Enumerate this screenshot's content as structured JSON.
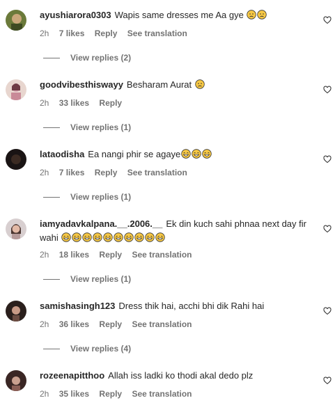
{
  "comments": [
    {
      "username": "ayushiarora0303",
      "text": "Wapis same dresses me Aa gye",
      "emojis": [
        "sad-face",
        "sad-face"
      ],
      "time": "2h",
      "likes": "7 likes",
      "reply": "Reply",
      "translate": "See translation",
      "view_replies": "View replies (2)",
      "avatar_colors": [
        "#6b7a3a",
        "#c9a77a"
      ]
    },
    {
      "username": "goodvibesthiswayy",
      "text": "Besharam Aurat",
      "emojis": [
        "sad-face"
      ],
      "time": "2h",
      "likes": "33 likes",
      "reply": "Reply",
      "translate": "",
      "view_replies": "View replies (1)",
      "avatar_colors": [
        "#d9a6b2",
        "#6e3b45"
      ]
    },
    {
      "username": "lataodisha",
      "text": "Ea nangi phir se agaye",
      "emojis": [
        "laughing-face",
        "laughing-face",
        "laughing-face"
      ],
      "time": "2h",
      "likes": "7 likes",
      "reply": "Reply",
      "translate": "See translation",
      "view_replies": "View replies (1)",
      "avatar_colors": [
        "#1a1414",
        "#3b2a22"
      ]
    },
    {
      "username": "iamyadavkalpana.__.2006.__",
      "text": "Ek din kuch sahi phnaa next day fir wahi",
      "emojis": [
        "laughing-face",
        "laughing-face",
        "laughing-face",
        "laughing-face",
        "laughing-face",
        "laughing-face",
        "laughing-face",
        "laughing-face",
        "laughing-face",
        "laughing-face"
      ],
      "time": "2h",
      "likes": "18 likes",
      "reply": "Reply",
      "translate": "See translation",
      "view_replies": "View replies (1)",
      "avatar_colors": [
        "#d8cfd0",
        "#4a3530"
      ]
    },
    {
      "username": "samishasingh123",
      "text": "Dress thik hai, acchi bhi dik Rahi hai",
      "emojis": [],
      "time": "2h",
      "likes": "36 likes",
      "reply": "Reply",
      "translate": "See translation",
      "view_replies": "View replies (4)",
      "avatar_colors": [
        "#2a1f1c",
        "#c89a86"
      ]
    },
    {
      "username": "rozeenapitthoo",
      "text": "Allah iss ladki ko thodi akal dedo plz",
      "emojis": [],
      "time": "2h",
      "likes": "35 likes",
      "reply": "Reply",
      "translate": "See translation",
      "view_replies": "",
      "avatar_colors": [
        "#3a2624",
        "#caa08f"
      ]
    }
  ],
  "colors": {
    "text": "#262626",
    "secondary": "#737373",
    "emoji": "#f7c844"
  },
  "icons": {
    "like": "heart-outline-icon"
  }
}
